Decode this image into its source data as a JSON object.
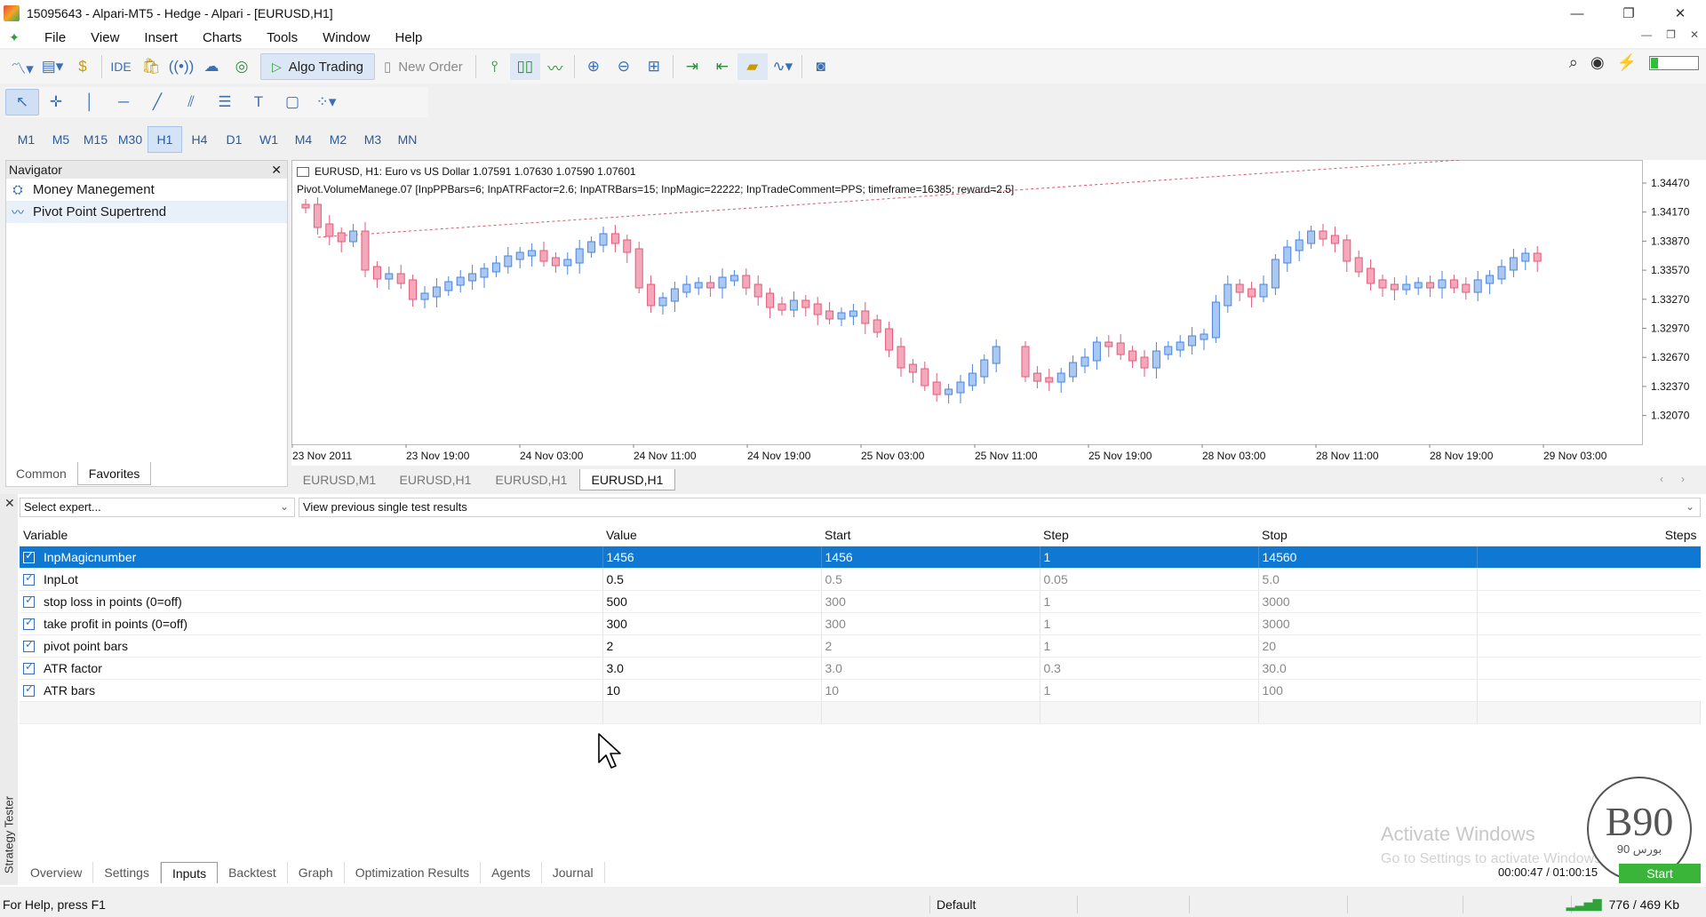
{
  "window": {
    "title": "15095643 - Alpari-MT5 - Hedge - Alpari - [EURUSD,H1]",
    "controls": [
      "—",
      "❐",
      "✕"
    ]
  },
  "menu": [
    "File",
    "View",
    "Insert",
    "Charts",
    "Tools",
    "Window",
    "Help"
  ],
  "toolbar": {
    "ide": "IDE",
    "algo_trading": "Algo Trading",
    "new_order": "New Order"
  },
  "timeframes": [
    "M1",
    "M5",
    "M15",
    "M30",
    "H1",
    "H4",
    "D1",
    "W1",
    "M4",
    "M2",
    "M3",
    "MN"
  ],
  "active_timeframe": "H1",
  "navigator": {
    "title": "Navigator",
    "items": [
      {
        "label": "Money Manegement",
        "icon": "book-icon"
      },
      {
        "label": "Pivot Point Supertrend",
        "icon": "indicator-icon"
      }
    ],
    "tabs": [
      "Common",
      "Favorites"
    ],
    "active_tab": "Favorites"
  },
  "chart": {
    "header": "EURUSD, H1:  Euro vs US Dollar  1.07591 1.07630 1.07590 1.07601",
    "indicator": "Pivot.VolumeManege.07 [InpPPBars=6; InpATRFactor=2.6; InpATRBars=15; InpMagic=22222; InpTradeComment=PPS; timeframe=16385; reward=2.5]",
    "price_labels": [
      "1.34470",
      "1.34170",
      "1.33870",
      "1.33570",
      "1.33270",
      "1.32970",
      "1.32670",
      "1.32370",
      "1.32070"
    ],
    "time_labels": [
      "23 Nov 2011",
      "23 Nov 19:00",
      "24 Nov 03:00",
      "24 Nov 11:00",
      "24 Nov 19:00",
      "25 Nov 03:00",
      "25 Nov 11:00",
      "25 Nov 19:00",
      "28 Nov 03:00",
      "28 Nov 11:00",
      "28 Nov 19:00",
      "29 Nov 03:00"
    ],
    "colors": {
      "bull": "#4a84e0",
      "bear": "#e05a78",
      "bull_fill": "#a9c8f2",
      "bear_fill": "#f3a9bb"
    }
  },
  "chart_tabs": [
    "EURUSD,M1",
    "EURUSD,H1",
    "EURUSD,H1",
    "EURUSD,H1"
  ],
  "active_chart_tab": 3,
  "tester": {
    "side_label": "Strategy Tester",
    "expert_select": "Select expert...",
    "results_select": "View previous single test results",
    "columns": [
      "Variable",
      "Value",
      "Start",
      "Step",
      "Stop",
      "Steps"
    ],
    "rows": [
      {
        "variable": "InpMagicnumber",
        "value": "1456",
        "start": "1456",
        "step": "1",
        "stop": "14560",
        "selected": true
      },
      {
        "variable": "InpLot",
        "value": "0.5",
        "start": "0.5",
        "step": "0.05",
        "stop": "5.0"
      },
      {
        "variable": "stop loss in points (0=off)",
        "value": "500",
        "start": "300",
        "step": "1",
        "stop": "3000"
      },
      {
        "variable": "take profit in points (0=off)",
        "value": "300",
        "start": "300",
        "step": "1",
        "stop": "3000"
      },
      {
        "variable": "pivot point bars",
        "value": "2",
        "start": "2",
        "step": "1",
        "stop": "20"
      },
      {
        "variable": "ATR factor",
        "value": "3.0",
        "start": "3.0",
        "step": "0.3",
        "stop": "30.0"
      },
      {
        "variable": "ATR bars",
        "value": "10",
        "start": "10",
        "step": "1",
        "stop": "100"
      }
    ],
    "bottom_tabs": [
      "Overview",
      "Settings",
      "Inputs",
      "Backtest",
      "Graph",
      "Optimization Results",
      "Agents",
      "Journal"
    ],
    "active_bottom_tab": "Inputs",
    "timer": "00:00:47 / 01:00:15",
    "start_label": "Start"
  },
  "watermark": {
    "line1": "Activate Windows",
    "line2": "Go to Settings to activate Windows.",
    "logo": "B90",
    "logo_sub": "بورس 90"
  },
  "status": {
    "help": "For Help, press F1",
    "profile": "Default",
    "traffic": "776 / 469 Kb"
  }
}
